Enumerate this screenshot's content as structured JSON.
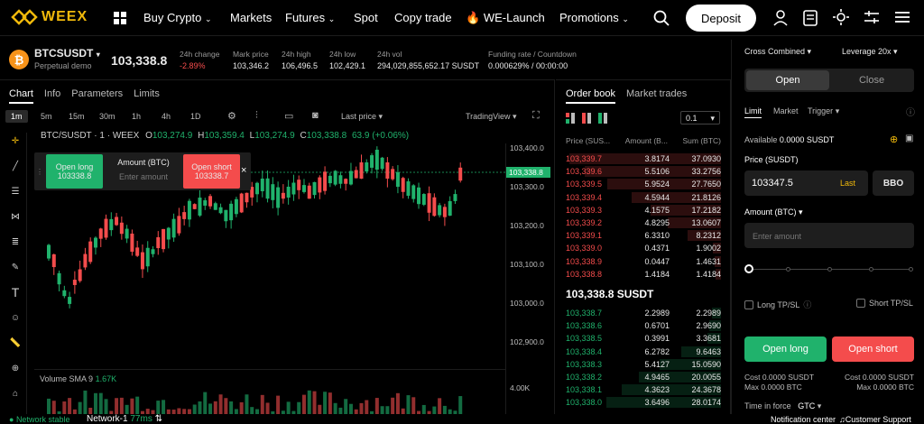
{
  "nav": {
    "brand": "WEEX",
    "items": [
      {
        "label": "Buy Crypto"
      },
      {
        "label": "Markets"
      },
      {
        "label": "Futures"
      },
      {
        "label": "Spot"
      },
      {
        "label": "Copy trade"
      },
      {
        "label": "WE-Launch"
      },
      {
        "label": "Promotions"
      }
    ],
    "deposit": "Deposit"
  },
  "ticker": {
    "symbol": "BTCSUSDT",
    "subtitle": "Perpetual demo",
    "last_price": "103,338.8",
    "stats": [
      {
        "label": "24h change",
        "value": "-2.89%"
      },
      {
        "label": "Mark price",
        "value": "103,346.2"
      },
      {
        "label": "24h high",
        "value": "106,496.5"
      },
      {
        "label": "24h low",
        "value": "102,429.1"
      },
      {
        "label": "24h vol",
        "value": "294,029,855,652.17 SUSDT"
      },
      {
        "label": "Funding rate / Countdown",
        "value": "0.000629% / 00:00:00"
      }
    ]
  },
  "chart": {
    "tabs": [
      "Chart",
      "Info",
      "Parameters",
      "Limits"
    ],
    "intervals": [
      "1m",
      "5m",
      "15m",
      "30m",
      "1h",
      "4h",
      "1D"
    ],
    "active_interval": "1m",
    "price_type": "Last price",
    "view": "TradingView",
    "legend": "BTC/SUSDT · 1 · WEEX",
    "ohlc": {
      "O": "103,274.9",
      "H": "103,359.4",
      "L": "103,274.9",
      "C": "103,338.8",
      "change": "63.9 (+0.06%)"
    },
    "price_scale": [
      "103,400.0",
      "103,300.0",
      "103,200.0",
      "103,100.0",
      "103,000.0",
      "102,900.0"
    ],
    "current_price_tag": "103,338.8",
    "volume_label": "Volume SMA 9",
    "volume_value": "1.67K",
    "volume_scale": "4.00K",
    "quick_trade": {
      "long_label": "Open long",
      "long_price": "103338.8",
      "amount_label": "Amount (BTC)",
      "amount_placeholder": "Enter amount",
      "short_label": "Open short",
      "short_price": "103338.7"
    }
  },
  "orderbook": {
    "tabs": [
      "Order book",
      "Market trades"
    ],
    "precision": "0.1",
    "headers": [
      "Price (SUS...",
      "Amount (B...",
      "Sum (BTC)"
    ],
    "asks": [
      [
        "103,339.7",
        "3.8174",
        "37.0930"
      ],
      [
        "103,339.6",
        "5.5106",
        "33.2756"
      ],
      [
        "103,339.5",
        "5.9524",
        "27.7650"
      ],
      [
        "103,339.4",
        "4.5944",
        "21.8126"
      ],
      [
        "103,339.3",
        "4.1575",
        "17.2182"
      ],
      [
        "103,339.2",
        "4.8295",
        "13.0607"
      ],
      [
        "103,339.1",
        "6.3310",
        "8.2312"
      ],
      [
        "103,339.0",
        "0.4371",
        "1.9002"
      ],
      [
        "103,338.9",
        "0.0447",
        "1.4631"
      ],
      [
        "103,338.8",
        "1.4184",
        "1.4184"
      ]
    ],
    "mid_price": "103,338.8 SUSDT",
    "bids": [
      [
        "103,338.7",
        "2.2989",
        "2.2989"
      ],
      [
        "103,338.6",
        "0.6701",
        "2.9690"
      ],
      [
        "103,338.5",
        "0.3991",
        "3.3681"
      ],
      [
        "103,338.4",
        "6.2782",
        "9.6463"
      ],
      [
        "103,338.3",
        "5.4127",
        "15.0590"
      ],
      [
        "103,338.2",
        "4.9465",
        "20.0055"
      ],
      [
        "103,338.1",
        "4.3623",
        "24.3678"
      ],
      [
        "103,338.0",
        "3.6496",
        "28.0174"
      ]
    ]
  },
  "trade": {
    "margin_mode": "Cross Combined",
    "leverage": "Leverage 20x",
    "open": "Open",
    "close": "Close",
    "order_types": [
      "Limit",
      "Market",
      "Trigger"
    ],
    "available_label": "Available",
    "available_value": "0.0000 SUSDT",
    "price_label": "Price (SUSDT)",
    "price_value": "103347.5",
    "last_btn": "Last",
    "bbo": "BBO",
    "amount_label": "Amount (BTC)",
    "amount_placeholder": "Enter amount",
    "long_tpsl": "Long TP/SL",
    "short_tpsl": "Short TP/SL",
    "open_long": "Open long",
    "open_short": "Open short",
    "cost_long": "Cost 0.0000 SUSDT",
    "max_long": "Max 0.0000 BTC",
    "cost_short": "Cost 0.0000 SUSDT",
    "max_short": "Max 0.0000 BTC",
    "tif_label": "Time in force",
    "tif_value": "GTC"
  },
  "status": {
    "network": "Network stable",
    "network_name": "Network-1",
    "latency": "77ms",
    "notification": "Notification center",
    "support": "Customer Support"
  },
  "colors": {
    "up": "#20b26c",
    "down": "#f44c4c",
    "brand": "#f0b90b"
  }
}
